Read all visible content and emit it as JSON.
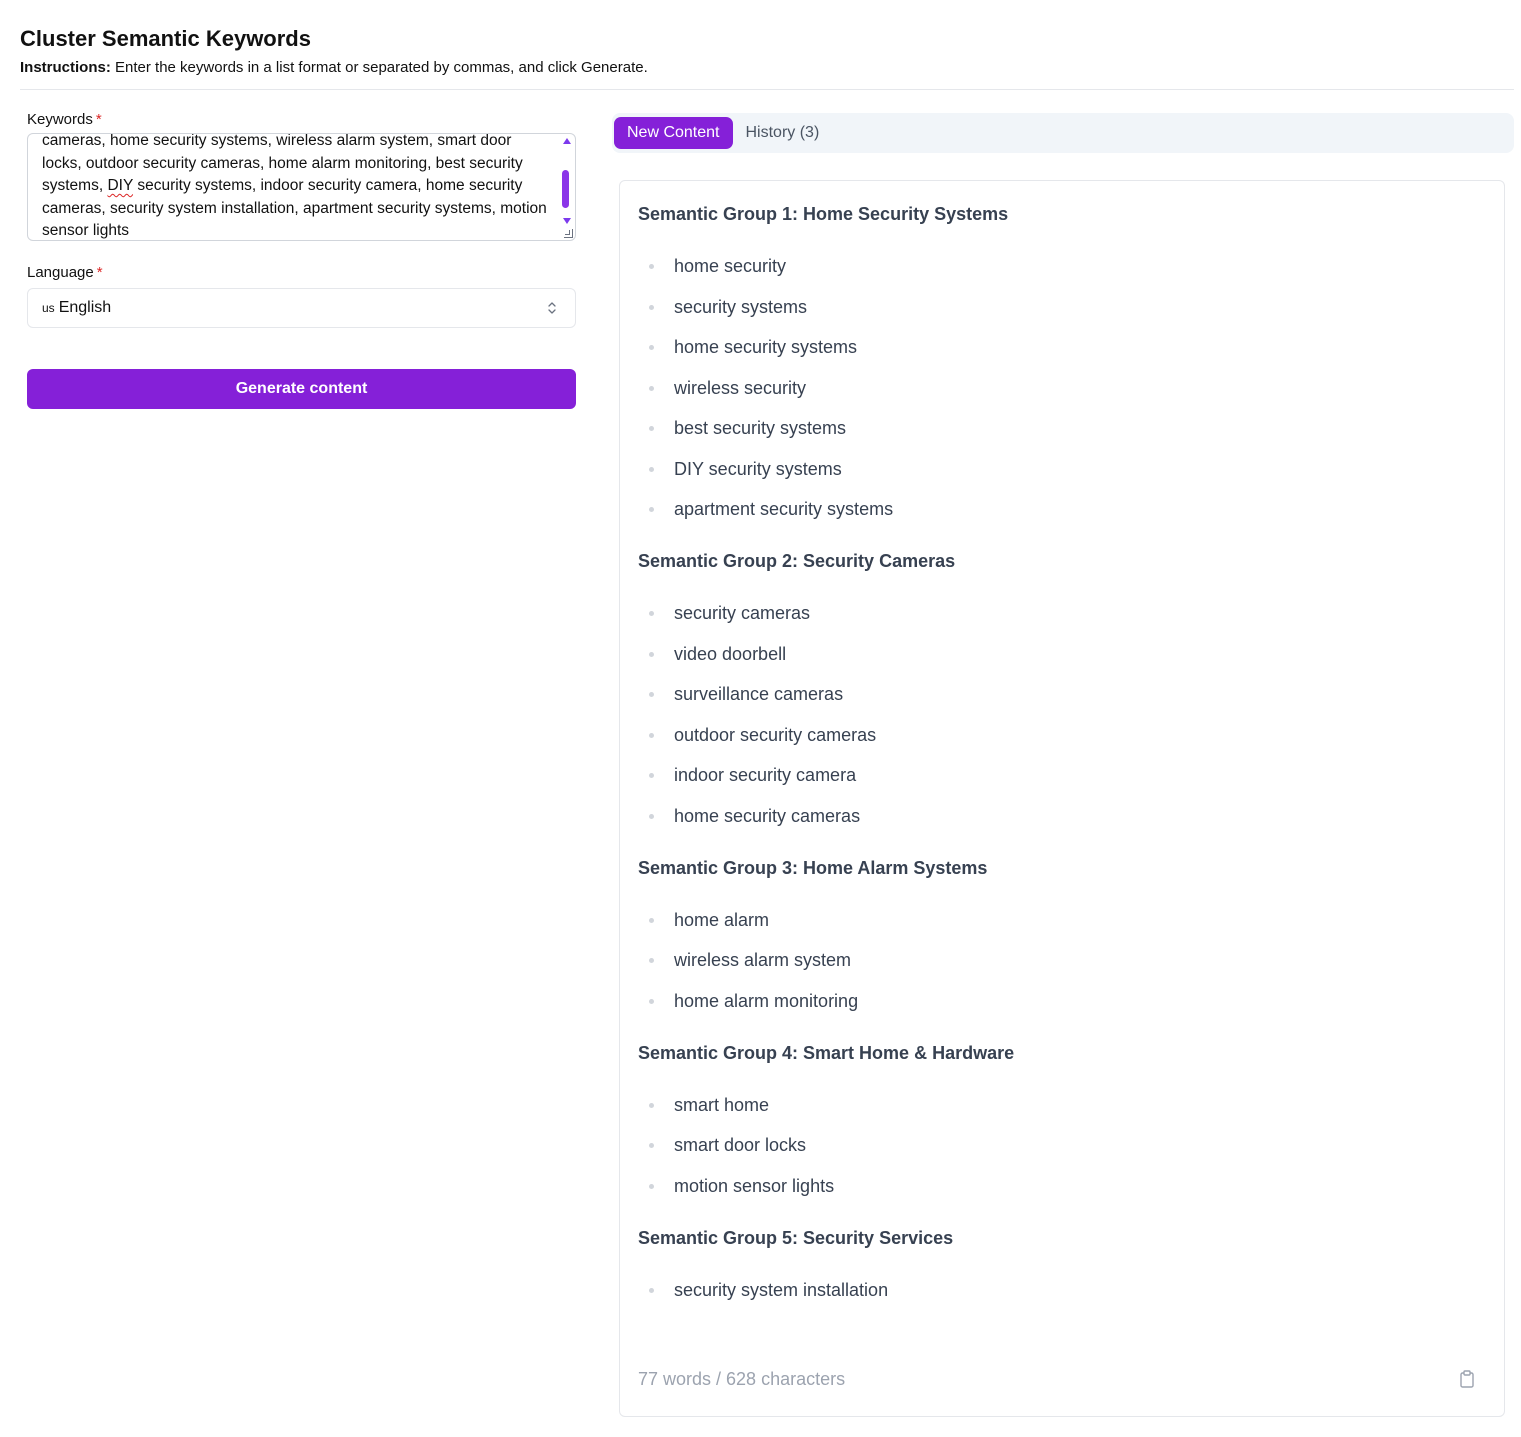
{
  "header": {
    "title": "Cluster Semantic Keywords",
    "instructions_label": "Instructions:",
    "instructions_text": " Enter the keywords in a list format or separated by commas, and click Generate."
  },
  "form": {
    "keywords_label": "Keywords",
    "required_mark": "*",
    "keywords_value_before": "cameras, home security systems, wireless alarm system, smart door locks, outdoor security cameras, home alarm monitoring, best security systems, ",
    "keywords_value_misspelled": "DIY",
    "keywords_value_after": " security systems, indoor security camera, home security cameras, security system installation, apartment security systems, motion sensor lights",
    "language_label": "Language",
    "language_flag": "us",
    "language_value": "English",
    "generate_label": "Generate content"
  },
  "tabs": [
    {
      "label": "New Content",
      "active": true
    },
    {
      "label": "History (3)",
      "active": false
    }
  ],
  "result": {
    "groups": [
      {
        "title": "Semantic Group 1: Home Security Systems",
        "items": [
          "home security",
          "security systems",
          "home security systems",
          "wireless security",
          "best security systems",
          "DIY security systems",
          "apartment security systems"
        ]
      },
      {
        "title": "Semantic Group 2: Security Cameras",
        "items": [
          "security cameras",
          "video doorbell",
          "surveillance cameras",
          "outdoor security cameras",
          "indoor security camera",
          "home security cameras"
        ]
      },
      {
        "title": "Semantic Group 3: Home Alarm Systems",
        "items": [
          "home alarm",
          "wireless alarm system",
          "home alarm monitoring"
        ]
      },
      {
        "title": "Semantic Group 4: Smart Home & Hardware",
        "items": [
          "smart home",
          "smart door locks",
          "motion sensor lights"
        ]
      },
      {
        "title": "Semantic Group 5: Security Services",
        "items": [
          "security system installation"
        ]
      }
    ],
    "count_text": "77 words / 628 characters",
    "copy_icon": "clipboard-icon"
  },
  "colors": {
    "accent": "#8520d8",
    "required": "#dc2626",
    "muted_text": "#9ca3af"
  }
}
